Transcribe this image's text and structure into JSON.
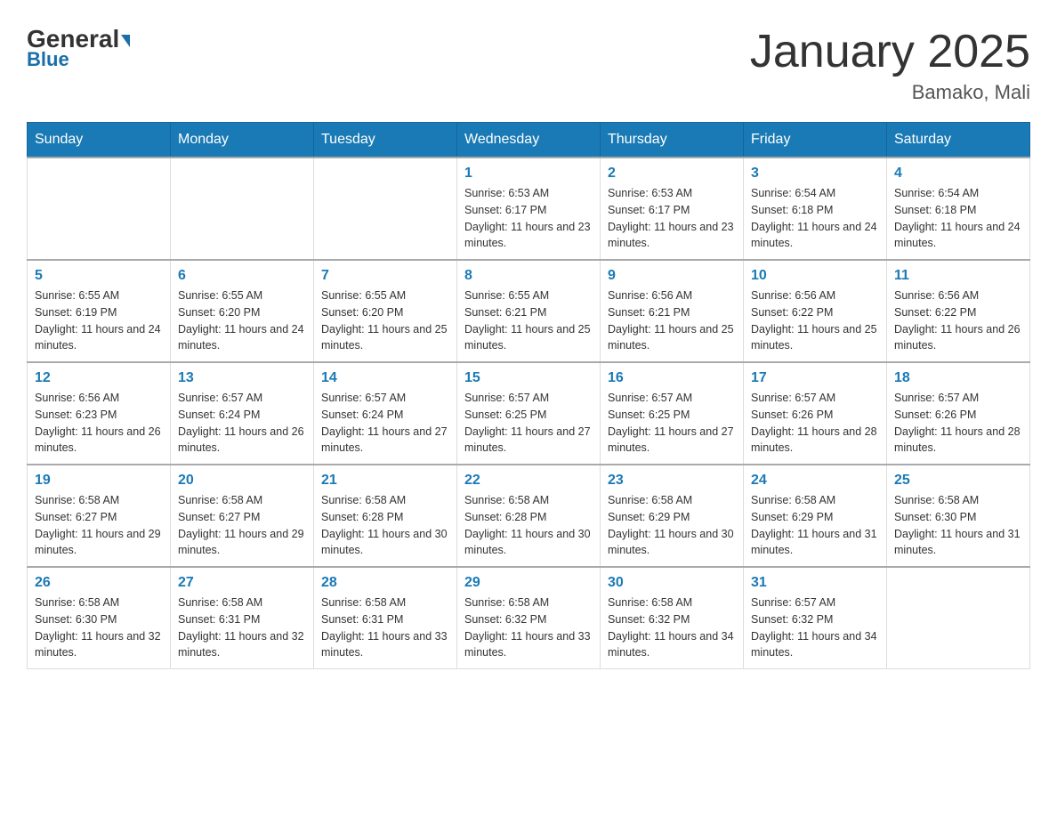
{
  "header": {
    "logo_general": "General",
    "logo_blue": "Blue",
    "title": "January 2025",
    "subtitle": "Bamako, Mali"
  },
  "days_of_week": [
    "Sunday",
    "Monday",
    "Tuesday",
    "Wednesday",
    "Thursday",
    "Friday",
    "Saturday"
  ],
  "weeks": [
    [
      {
        "day": "",
        "info": ""
      },
      {
        "day": "",
        "info": ""
      },
      {
        "day": "",
        "info": ""
      },
      {
        "day": "1",
        "info": "Sunrise: 6:53 AM\nSunset: 6:17 PM\nDaylight: 11 hours and 23 minutes."
      },
      {
        "day": "2",
        "info": "Sunrise: 6:53 AM\nSunset: 6:17 PM\nDaylight: 11 hours and 23 minutes."
      },
      {
        "day": "3",
        "info": "Sunrise: 6:54 AM\nSunset: 6:18 PM\nDaylight: 11 hours and 24 minutes."
      },
      {
        "day": "4",
        "info": "Sunrise: 6:54 AM\nSunset: 6:18 PM\nDaylight: 11 hours and 24 minutes."
      }
    ],
    [
      {
        "day": "5",
        "info": "Sunrise: 6:55 AM\nSunset: 6:19 PM\nDaylight: 11 hours and 24 minutes."
      },
      {
        "day": "6",
        "info": "Sunrise: 6:55 AM\nSunset: 6:20 PM\nDaylight: 11 hours and 24 minutes."
      },
      {
        "day": "7",
        "info": "Sunrise: 6:55 AM\nSunset: 6:20 PM\nDaylight: 11 hours and 25 minutes."
      },
      {
        "day": "8",
        "info": "Sunrise: 6:55 AM\nSunset: 6:21 PM\nDaylight: 11 hours and 25 minutes."
      },
      {
        "day": "9",
        "info": "Sunrise: 6:56 AM\nSunset: 6:21 PM\nDaylight: 11 hours and 25 minutes."
      },
      {
        "day": "10",
        "info": "Sunrise: 6:56 AM\nSunset: 6:22 PM\nDaylight: 11 hours and 25 minutes."
      },
      {
        "day": "11",
        "info": "Sunrise: 6:56 AM\nSunset: 6:22 PM\nDaylight: 11 hours and 26 minutes."
      }
    ],
    [
      {
        "day": "12",
        "info": "Sunrise: 6:56 AM\nSunset: 6:23 PM\nDaylight: 11 hours and 26 minutes."
      },
      {
        "day": "13",
        "info": "Sunrise: 6:57 AM\nSunset: 6:24 PM\nDaylight: 11 hours and 26 minutes."
      },
      {
        "day": "14",
        "info": "Sunrise: 6:57 AM\nSunset: 6:24 PM\nDaylight: 11 hours and 27 minutes."
      },
      {
        "day": "15",
        "info": "Sunrise: 6:57 AM\nSunset: 6:25 PM\nDaylight: 11 hours and 27 minutes."
      },
      {
        "day": "16",
        "info": "Sunrise: 6:57 AM\nSunset: 6:25 PM\nDaylight: 11 hours and 27 minutes."
      },
      {
        "day": "17",
        "info": "Sunrise: 6:57 AM\nSunset: 6:26 PM\nDaylight: 11 hours and 28 minutes."
      },
      {
        "day": "18",
        "info": "Sunrise: 6:57 AM\nSunset: 6:26 PM\nDaylight: 11 hours and 28 minutes."
      }
    ],
    [
      {
        "day": "19",
        "info": "Sunrise: 6:58 AM\nSunset: 6:27 PM\nDaylight: 11 hours and 29 minutes."
      },
      {
        "day": "20",
        "info": "Sunrise: 6:58 AM\nSunset: 6:27 PM\nDaylight: 11 hours and 29 minutes."
      },
      {
        "day": "21",
        "info": "Sunrise: 6:58 AM\nSunset: 6:28 PM\nDaylight: 11 hours and 30 minutes."
      },
      {
        "day": "22",
        "info": "Sunrise: 6:58 AM\nSunset: 6:28 PM\nDaylight: 11 hours and 30 minutes."
      },
      {
        "day": "23",
        "info": "Sunrise: 6:58 AM\nSunset: 6:29 PM\nDaylight: 11 hours and 30 minutes."
      },
      {
        "day": "24",
        "info": "Sunrise: 6:58 AM\nSunset: 6:29 PM\nDaylight: 11 hours and 31 minutes."
      },
      {
        "day": "25",
        "info": "Sunrise: 6:58 AM\nSunset: 6:30 PM\nDaylight: 11 hours and 31 minutes."
      }
    ],
    [
      {
        "day": "26",
        "info": "Sunrise: 6:58 AM\nSunset: 6:30 PM\nDaylight: 11 hours and 32 minutes."
      },
      {
        "day": "27",
        "info": "Sunrise: 6:58 AM\nSunset: 6:31 PM\nDaylight: 11 hours and 32 minutes."
      },
      {
        "day": "28",
        "info": "Sunrise: 6:58 AM\nSunset: 6:31 PM\nDaylight: 11 hours and 33 minutes."
      },
      {
        "day": "29",
        "info": "Sunrise: 6:58 AM\nSunset: 6:32 PM\nDaylight: 11 hours and 33 minutes."
      },
      {
        "day": "30",
        "info": "Sunrise: 6:58 AM\nSunset: 6:32 PM\nDaylight: 11 hours and 34 minutes."
      },
      {
        "day": "31",
        "info": "Sunrise: 6:57 AM\nSunset: 6:32 PM\nDaylight: 11 hours and 34 minutes."
      },
      {
        "day": "",
        "info": ""
      }
    ]
  ]
}
